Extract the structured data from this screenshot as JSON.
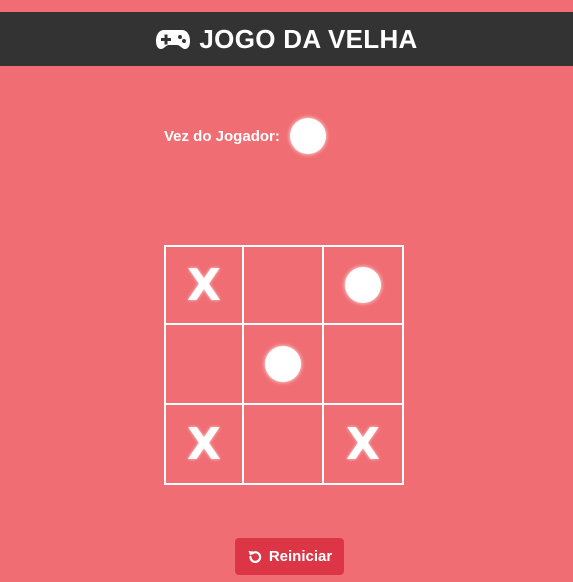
{
  "header": {
    "title": "JOGO DA VELHA",
    "icon": "gamepad-icon"
  },
  "turn": {
    "label": "Vez do Jogador:",
    "current_player": "O"
  },
  "board": {
    "cells": [
      "X",
      "",
      "O",
      "",
      "O",
      "",
      "X",
      "",
      "X"
    ]
  },
  "actions": {
    "restart_label": "Reiniciar",
    "restart_icon": "undo-icon"
  },
  "colors": {
    "background": "#f06e73",
    "header": "#333333",
    "button": "#dc3545",
    "mark": "#ffffff"
  }
}
